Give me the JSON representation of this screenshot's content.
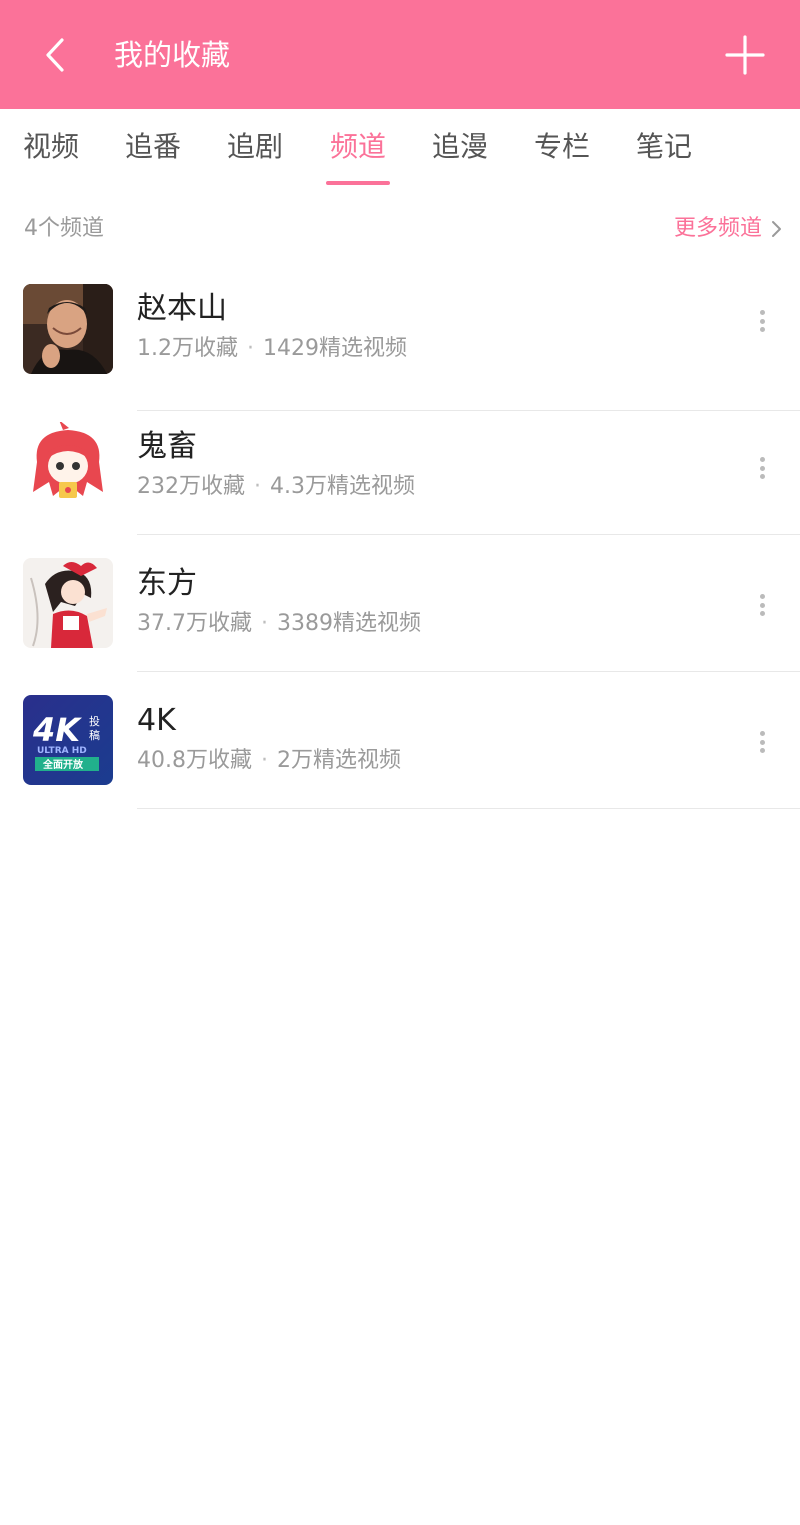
{
  "header": {
    "title": "我的收藏",
    "back_icon": "back-arrow-icon",
    "add_icon": "plus-icon",
    "background_color": "#fb7299",
    "text_color": "#ffffff"
  },
  "tabs": [
    {
      "label": "视频",
      "active": false
    },
    {
      "label": "追番",
      "active": false
    },
    {
      "label": "追剧",
      "active": false
    },
    {
      "label": "频道",
      "active": true
    },
    {
      "label": "追漫",
      "active": false
    },
    {
      "label": "专栏",
      "active": false
    },
    {
      "label": "笔记",
      "active": false
    }
  ],
  "section": {
    "count_label": "4个频道",
    "more_label": "更多频道",
    "more_icon": "chevron-right-icon",
    "accent_color": "#fb7299"
  },
  "channels": [
    {
      "name": "赵本山",
      "favorites": "1.2万收藏",
      "videos": "1429精选视频",
      "thumb": "person-portrait"
    },
    {
      "name": "鬼畜",
      "favorites": "232万收藏",
      "videos": "4.3万精选视频",
      "thumb": "red-hair-mascot"
    },
    {
      "name": "东方",
      "favorites": "37.7万收藏",
      "videos": "3389精选视频",
      "thumb": "anime-shrine-maiden"
    },
    {
      "name": "4K",
      "favorites": "40.8万收藏",
      "videos": "2万精选视频",
      "thumb": "4k-logo",
      "thumb_text": {
        "big": "4K",
        "side_top": "投",
        "side_bottom": "稿",
        "sub": "ULTRA HD",
        "banner": "全面开放"
      }
    }
  ],
  "meta_separator": "·",
  "more_menu_icon": "vertical-dots-icon"
}
